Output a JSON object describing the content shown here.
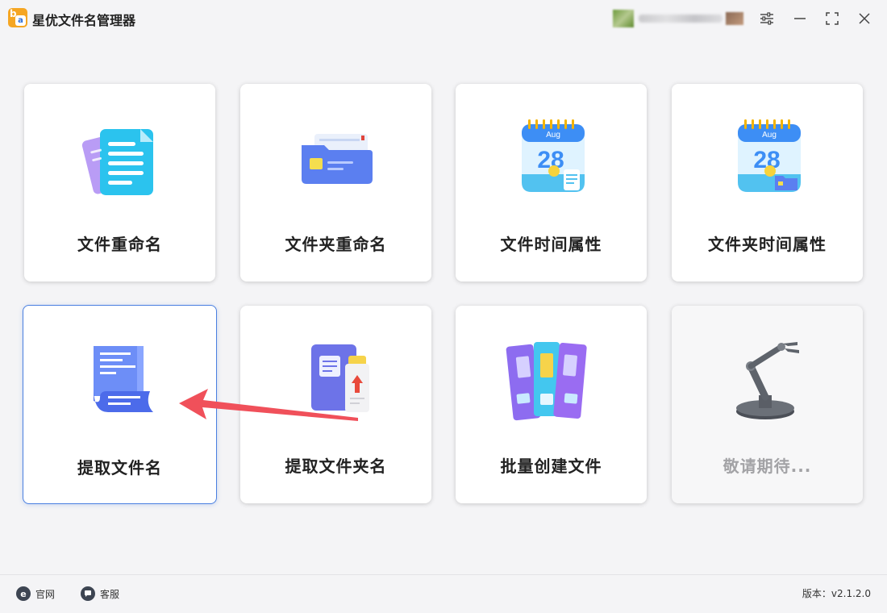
{
  "app": {
    "title": "星优文件名管理器",
    "logo_letters": {
      "b": "b",
      "a": "a"
    }
  },
  "window_controls": [
    "settings-icon",
    "minimize-icon",
    "maximize-icon",
    "close-icon"
  ],
  "cards": [
    {
      "label": "文件重命名",
      "icon": "document-rename-icon"
    },
    {
      "label": "文件夹重命名",
      "icon": "folder-rename-icon"
    },
    {
      "label": "文件时间属性",
      "icon": "calendar-file-icon",
      "calendar_month": "Aug",
      "calendar_day": "28"
    },
    {
      "label": "文件夹时间属性",
      "icon": "calendar-folder-icon",
      "calendar_month": "Aug",
      "calendar_day": "28"
    },
    {
      "label": "提取文件名",
      "icon": "scroll-document-icon",
      "selected": true
    },
    {
      "label": "提取文件夹名",
      "icon": "folder-export-icon"
    },
    {
      "label": "批量创建文件",
      "icon": "binders-icon"
    },
    {
      "label": "敬请期待...",
      "icon": "robot-arm-icon",
      "disabled": true
    }
  ],
  "footer": {
    "site_label": "官网",
    "service_label": "客服",
    "version": "版本：v2.1.2.0"
  },
  "colors": {
    "accent": "#4a7fe0",
    "arrow": "#f0505a",
    "logo": "#f5a623"
  }
}
